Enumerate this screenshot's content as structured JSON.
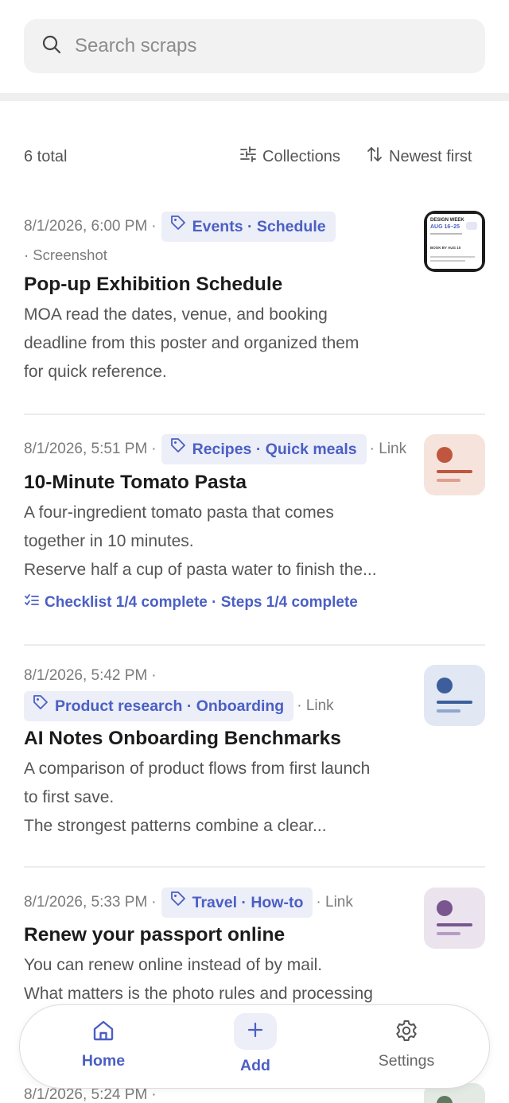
{
  "search": {
    "placeholder": "Search scraps"
  },
  "toolbar": {
    "total": "6 total",
    "collections": "Collections",
    "sort": "Newest first"
  },
  "scraps": [
    {
      "date": "8/1/2026, 6:00 PM",
      "sep_before_tag": "·",
      "tag": "Events · Schedule",
      "source": "· Screenshot",
      "title": "Pop-up Exhibition Schedule",
      "lines": [
        "MOA read the dates, venue, and booking",
        "deadline from this poster and organized them",
        "for quick reference."
      ],
      "thumb": {
        "heading": "DESIGN WEEK",
        "dates": "AUG 16–25",
        "sub": "BOOK BY AUG 10"
      }
    },
    {
      "date": "8/1/2026, 5:51 PM",
      "sep_before_tag": "·",
      "tag": "Recipes · Quick meals",
      "source": "· Link",
      "title": "10-Minute Tomato Pasta",
      "lines": [
        "A four-ingredient tomato pasta that comes",
        "together in 10 minutes.",
        "Reserve half a cup of pasta water to finish the..."
      ],
      "checklist": "Checklist 1/4 complete · Steps 1/4 complete",
      "thumb_color": "#f6e4dc",
      "thumb_accent": "#c0563e"
    },
    {
      "date": "8/1/2026, 5:42 PM",
      "sep_before_tag": "·",
      "tag": "Product research · Onboarding",
      "source": "· Link",
      "title": "AI Notes Onboarding Benchmarks",
      "lines": [
        "A comparison of product flows from first launch",
        "to first save.",
        "The strongest patterns combine a clear..."
      ],
      "thumb_color": "#e1e7f3",
      "thumb_accent": "#3c5f9c"
    },
    {
      "date": "8/1/2026, 5:33 PM",
      "sep_before_tag": "·",
      "tag": "Travel · How-to",
      "source": "· Link",
      "title": "Renew your passport online",
      "lines": [
        "You can renew online instead of by mail.",
        "What matters is the photo rules and processing"
      ],
      "thumb_color": "#ebe3ee",
      "thumb_accent": "#7a5690"
    },
    {
      "date": "8/1/2026, 5:24 PM",
      "sep_before_tag": "·",
      "thumb_color": "#e3e9e3",
      "thumb_accent": "#5f7a5f"
    }
  ],
  "nav": {
    "home": "Home",
    "add": "Add",
    "settings": "Settings"
  },
  "colors": {
    "accent": "#4b5fc4",
    "tag_bg": "#eceef8"
  },
  "icons": [
    "search-icon",
    "filter-icon",
    "sort-icon",
    "tag-icon",
    "checklist-icon",
    "home-icon",
    "plus-icon",
    "gear-icon"
  ]
}
